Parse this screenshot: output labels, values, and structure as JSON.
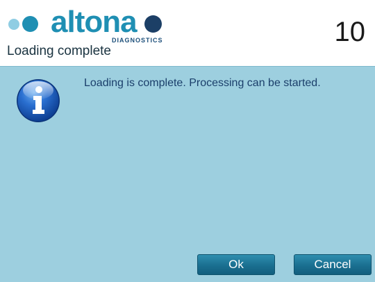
{
  "header": {
    "logo": {
      "wordmark": "altona",
      "subtitle": "DIAGNOSTICS",
      "colors": {
        "light_dot": "#8fcde3",
        "brand_blue": "#1f8fb3",
        "dark_dot": "#1c3f66"
      }
    },
    "step_number": "10",
    "title": "Loading complete"
  },
  "dialog": {
    "icon": "info-icon",
    "message": "Loading is complete. Processing can be started.",
    "background_color": "#9dcfdf",
    "buttons": {
      "ok_label": "Ok",
      "cancel_label": "Cancel"
    }
  }
}
